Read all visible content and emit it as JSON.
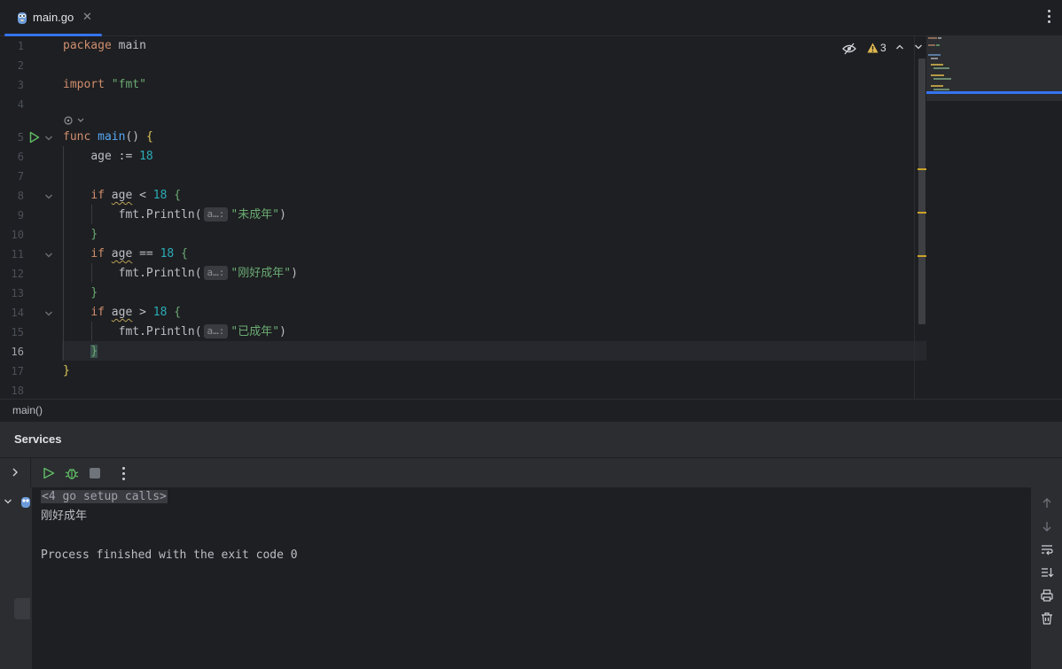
{
  "tab": {
    "label": "main.go",
    "close": "✕"
  },
  "editor": {
    "line_numbers": [
      "1",
      "2",
      "3",
      "4",
      "5",
      "6",
      "7",
      "8",
      "9",
      "10",
      "11",
      "12",
      "13",
      "14",
      "15",
      "16",
      "17",
      "18"
    ],
    "code": {
      "l1_kw": "package",
      "l1_name": "main",
      "l3_kw": "import",
      "l3_str": "\"fmt\"",
      "l5_kw": "func",
      "l5_fn": "main",
      "l5_paren": "()",
      "l5_brace": "{",
      "l6_var": "age",
      "l6_op": " := ",
      "l6_num": "18",
      "l8_kw": "if",
      "l8_var": "age",
      "l8_op": " < ",
      "l8_num": "18",
      "l8_brace": "{",
      "l9_call": "fmt.Println(",
      "l9_hint": "a…:",
      "l9_str": "\"未成年\"",
      "l9_close": ")",
      "l10_brace": "}",
      "l11_kw": "if",
      "l11_var": "age",
      "l11_op": " == ",
      "l11_num": "18",
      "l11_brace": "{",
      "l12_call": "fmt.Println(",
      "l12_hint": "a…:",
      "l12_str": "\"刚好成年\"",
      "l12_close": ")",
      "l13_brace": "}",
      "l14_kw": "if",
      "l14_var": "age",
      "l14_op": " > ",
      "l14_num": "18",
      "l14_brace": "{",
      "l15_call": "fmt.Println(",
      "l15_hint": "a…:",
      "l15_str": "\"已成年\"",
      "l15_close": ")",
      "l16_brace": "}",
      "l17_brace": "}"
    },
    "current_line": "16",
    "warning_count": "3"
  },
  "breadcrumb": {
    "item": "main()"
  },
  "services": {
    "title": "Services",
    "console": {
      "setup_calls": "<4 go setup calls>",
      "output": "刚好成年",
      "finished": "Process finished with the exit code 0"
    }
  },
  "colors": {
    "accent": "#3574f0",
    "keyword": "#cf8e6d",
    "function": "#56a8f5",
    "string": "#6aab73",
    "number": "#2aacb8",
    "warning": "#e0b94f"
  },
  "icons": [
    "go-file-icon",
    "close-icon",
    "more-icon",
    "run-icon",
    "fold-icon",
    "hidden-eye-icon",
    "warning-icon",
    "chevron-up-icon",
    "chevron-down-icon",
    "run-button-icon",
    "debug-icon",
    "stop-icon",
    "scroll-up-icon",
    "scroll-down-icon",
    "soft-wrap-icon",
    "scroll-to-end-icon",
    "print-icon",
    "trash-icon"
  ]
}
